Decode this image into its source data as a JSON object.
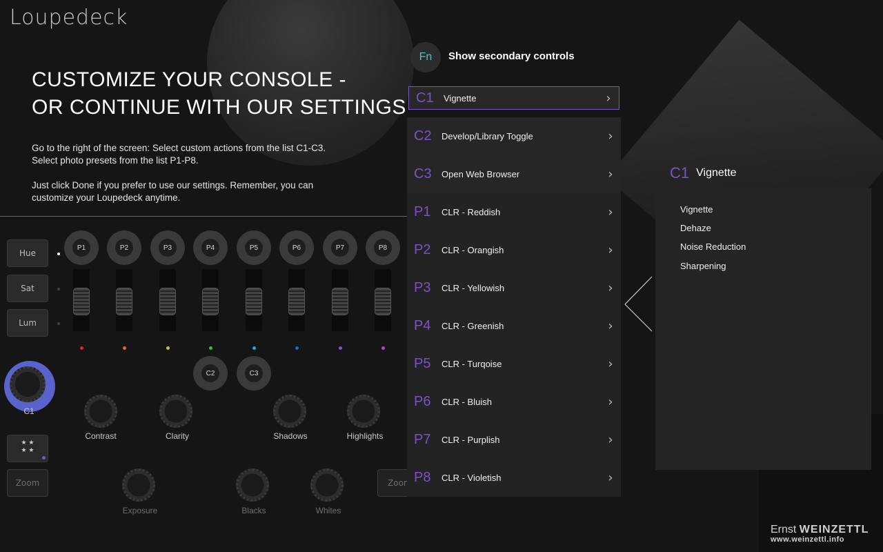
{
  "brand": {
    "logo_text": "Loupedeck"
  },
  "intro": {
    "headline_line1": "CUSTOMIZE YOUR CONSOLE -",
    "headline_line2": "OR CONTINUE WITH OUR SETTINGS",
    "paragraph1_line1": "Go to the right of the screen: Select custom actions from the list C1-C3.",
    "paragraph1_line2": "Select photo presets from the list P1-P8.",
    "paragraph2_line1": "Just click Done if you prefer to use our settings. Remember, you can",
    "paragraph2_line2": "customize your Loupedeck anytime."
  },
  "console": {
    "side_buttons": [
      "Hue",
      "Sat",
      "Lum"
    ],
    "preset_buttons": [
      "P1",
      "P2",
      "P3",
      "P4",
      "P5",
      "P6",
      "P7",
      "P8"
    ],
    "slider_colors": [
      "#d62a3c",
      "#e06a2a",
      "#c9c13a",
      "#2fbf4a",
      "#2fa6d9",
      "#2b62d9",
      "#8a4fd9",
      "#c23fc9"
    ],
    "custom_buttons": [
      "C2",
      "C3"
    ],
    "c1_label": "C1",
    "dials_row1": [
      "Contrast",
      "Clarity",
      "Shadows",
      "Highlights"
    ],
    "dials_row2": [
      "Exposure",
      "Blacks",
      "Whites"
    ],
    "zoom_left": "Zoom",
    "zoom_right": "Zoom"
  },
  "fn": {
    "badge": "Fn",
    "label": "Show secondary controls"
  },
  "list": [
    {
      "code": "C1",
      "label": "Vignette"
    },
    {
      "code": "C2",
      "label": "Develop/Library Toggle"
    },
    {
      "code": "C3",
      "label": "Open Web Browser"
    },
    {
      "code": "P1",
      "label": "CLR - Reddish"
    },
    {
      "code": "P2",
      "label": "CLR - Orangish"
    },
    {
      "code": "P3",
      "label": "CLR - Yellowish"
    },
    {
      "code": "P4",
      "label": "CLR - Greenish"
    },
    {
      "code": "P5",
      "label": "CLR - Turqoise"
    },
    {
      "code": "P6",
      "label": "CLR - Bluish"
    },
    {
      "code": "P7",
      "label": "CLR - Purplish"
    },
    {
      "code": "P8",
      "label": "CLR - Violetish"
    }
  ],
  "detail": {
    "code": "C1",
    "title": "Vignette",
    "options": [
      "Vignette",
      "Dehaze",
      "Noise Reduction",
      "Sharpening"
    ]
  },
  "credit": {
    "name_first": "Ernst",
    "name_last": "WEINZETTL",
    "url": "www.weinzettl.info"
  },
  "colors": {
    "accent_purple": "#7b52c9",
    "fn_teal": "#4fc4c4",
    "c1_ring": "#5a62cc"
  }
}
